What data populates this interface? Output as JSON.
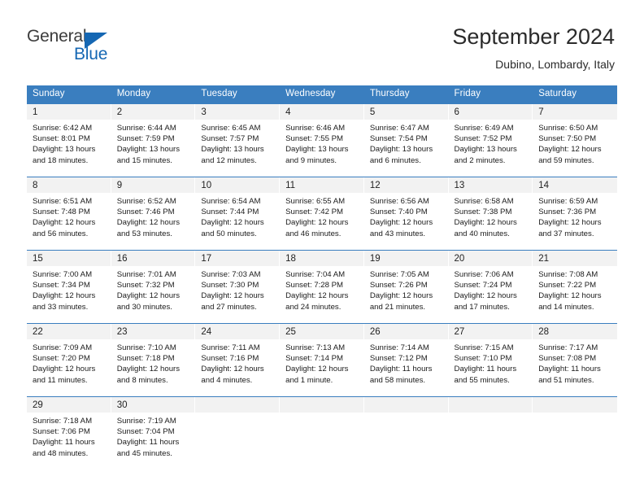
{
  "brand": {
    "name_part1": "General",
    "name_part2": "Blue",
    "accent_color": "#1567b3"
  },
  "header": {
    "title": "September 2024",
    "location": "Dubino, Lombardy, Italy"
  },
  "theme": {
    "header_band": "#3a7ebf",
    "day_band": "#f2f2f2"
  },
  "weekdays": [
    "Sunday",
    "Monday",
    "Tuesday",
    "Wednesday",
    "Thursday",
    "Friday",
    "Saturday"
  ],
  "weeks": [
    [
      {
        "day": "1",
        "sunrise": "Sunrise: 6:42 AM",
        "sunset": "Sunset: 8:01 PM",
        "daylight_line1": "Daylight: 13 hours",
        "daylight_line2": "and 18 minutes."
      },
      {
        "day": "2",
        "sunrise": "Sunrise: 6:44 AM",
        "sunset": "Sunset: 7:59 PM",
        "daylight_line1": "Daylight: 13 hours",
        "daylight_line2": "and 15 minutes."
      },
      {
        "day": "3",
        "sunrise": "Sunrise: 6:45 AM",
        "sunset": "Sunset: 7:57 PM",
        "daylight_line1": "Daylight: 13 hours",
        "daylight_line2": "and 12 minutes."
      },
      {
        "day": "4",
        "sunrise": "Sunrise: 6:46 AM",
        "sunset": "Sunset: 7:55 PM",
        "daylight_line1": "Daylight: 13 hours",
        "daylight_line2": "and 9 minutes."
      },
      {
        "day": "5",
        "sunrise": "Sunrise: 6:47 AM",
        "sunset": "Sunset: 7:54 PM",
        "daylight_line1": "Daylight: 13 hours",
        "daylight_line2": "and 6 minutes."
      },
      {
        "day": "6",
        "sunrise": "Sunrise: 6:49 AM",
        "sunset": "Sunset: 7:52 PM",
        "daylight_line1": "Daylight: 13 hours",
        "daylight_line2": "and 2 minutes."
      },
      {
        "day": "7",
        "sunrise": "Sunrise: 6:50 AM",
        "sunset": "Sunset: 7:50 PM",
        "daylight_line1": "Daylight: 12 hours",
        "daylight_line2": "and 59 minutes."
      }
    ],
    [
      {
        "day": "8",
        "sunrise": "Sunrise: 6:51 AM",
        "sunset": "Sunset: 7:48 PM",
        "daylight_line1": "Daylight: 12 hours",
        "daylight_line2": "and 56 minutes."
      },
      {
        "day": "9",
        "sunrise": "Sunrise: 6:52 AM",
        "sunset": "Sunset: 7:46 PM",
        "daylight_line1": "Daylight: 12 hours",
        "daylight_line2": "and 53 minutes."
      },
      {
        "day": "10",
        "sunrise": "Sunrise: 6:54 AM",
        "sunset": "Sunset: 7:44 PM",
        "daylight_line1": "Daylight: 12 hours",
        "daylight_line2": "and 50 minutes."
      },
      {
        "day": "11",
        "sunrise": "Sunrise: 6:55 AM",
        "sunset": "Sunset: 7:42 PM",
        "daylight_line1": "Daylight: 12 hours",
        "daylight_line2": "and 46 minutes."
      },
      {
        "day": "12",
        "sunrise": "Sunrise: 6:56 AM",
        "sunset": "Sunset: 7:40 PM",
        "daylight_line1": "Daylight: 12 hours",
        "daylight_line2": "and 43 minutes."
      },
      {
        "day": "13",
        "sunrise": "Sunrise: 6:58 AM",
        "sunset": "Sunset: 7:38 PM",
        "daylight_line1": "Daylight: 12 hours",
        "daylight_line2": "and 40 minutes."
      },
      {
        "day": "14",
        "sunrise": "Sunrise: 6:59 AM",
        "sunset": "Sunset: 7:36 PM",
        "daylight_line1": "Daylight: 12 hours",
        "daylight_line2": "and 37 minutes."
      }
    ],
    [
      {
        "day": "15",
        "sunrise": "Sunrise: 7:00 AM",
        "sunset": "Sunset: 7:34 PM",
        "daylight_line1": "Daylight: 12 hours",
        "daylight_line2": "and 33 minutes."
      },
      {
        "day": "16",
        "sunrise": "Sunrise: 7:01 AM",
        "sunset": "Sunset: 7:32 PM",
        "daylight_line1": "Daylight: 12 hours",
        "daylight_line2": "and 30 minutes."
      },
      {
        "day": "17",
        "sunrise": "Sunrise: 7:03 AM",
        "sunset": "Sunset: 7:30 PM",
        "daylight_line1": "Daylight: 12 hours",
        "daylight_line2": "and 27 minutes."
      },
      {
        "day": "18",
        "sunrise": "Sunrise: 7:04 AM",
        "sunset": "Sunset: 7:28 PM",
        "daylight_line1": "Daylight: 12 hours",
        "daylight_line2": "and 24 minutes."
      },
      {
        "day": "19",
        "sunrise": "Sunrise: 7:05 AM",
        "sunset": "Sunset: 7:26 PM",
        "daylight_line1": "Daylight: 12 hours",
        "daylight_line2": "and 21 minutes."
      },
      {
        "day": "20",
        "sunrise": "Sunrise: 7:06 AM",
        "sunset": "Sunset: 7:24 PM",
        "daylight_line1": "Daylight: 12 hours",
        "daylight_line2": "and 17 minutes."
      },
      {
        "day": "21",
        "sunrise": "Sunrise: 7:08 AM",
        "sunset": "Sunset: 7:22 PM",
        "daylight_line1": "Daylight: 12 hours",
        "daylight_line2": "and 14 minutes."
      }
    ],
    [
      {
        "day": "22",
        "sunrise": "Sunrise: 7:09 AM",
        "sunset": "Sunset: 7:20 PM",
        "daylight_line1": "Daylight: 12 hours",
        "daylight_line2": "and 11 minutes."
      },
      {
        "day": "23",
        "sunrise": "Sunrise: 7:10 AM",
        "sunset": "Sunset: 7:18 PM",
        "daylight_line1": "Daylight: 12 hours",
        "daylight_line2": "and 8 minutes."
      },
      {
        "day": "24",
        "sunrise": "Sunrise: 7:11 AM",
        "sunset": "Sunset: 7:16 PM",
        "daylight_line1": "Daylight: 12 hours",
        "daylight_line2": "and 4 minutes."
      },
      {
        "day": "25",
        "sunrise": "Sunrise: 7:13 AM",
        "sunset": "Sunset: 7:14 PM",
        "daylight_line1": "Daylight: 12 hours",
        "daylight_line2": "and 1 minute."
      },
      {
        "day": "26",
        "sunrise": "Sunrise: 7:14 AM",
        "sunset": "Sunset: 7:12 PM",
        "daylight_line1": "Daylight: 11 hours",
        "daylight_line2": "and 58 minutes."
      },
      {
        "day": "27",
        "sunrise": "Sunrise: 7:15 AM",
        "sunset": "Sunset: 7:10 PM",
        "daylight_line1": "Daylight: 11 hours",
        "daylight_line2": "and 55 minutes."
      },
      {
        "day": "28",
        "sunrise": "Sunrise: 7:17 AM",
        "sunset": "Sunset: 7:08 PM",
        "daylight_line1": "Daylight: 11 hours",
        "daylight_line2": "and 51 minutes."
      }
    ],
    [
      {
        "day": "29",
        "sunrise": "Sunrise: 7:18 AM",
        "sunset": "Sunset: 7:06 PM",
        "daylight_line1": "Daylight: 11 hours",
        "daylight_line2": "and 48 minutes."
      },
      {
        "day": "30",
        "sunrise": "Sunrise: 7:19 AM",
        "sunset": "Sunset: 7:04 PM",
        "daylight_line1": "Daylight: 11 hours",
        "daylight_line2": "and 45 minutes."
      },
      {
        "day": "",
        "sunrise": "",
        "sunset": "",
        "daylight_line1": "",
        "daylight_line2": ""
      },
      {
        "day": "",
        "sunrise": "",
        "sunset": "",
        "daylight_line1": "",
        "daylight_line2": ""
      },
      {
        "day": "",
        "sunrise": "",
        "sunset": "",
        "daylight_line1": "",
        "daylight_line2": ""
      },
      {
        "day": "",
        "sunrise": "",
        "sunset": "",
        "daylight_line1": "",
        "daylight_line2": ""
      },
      {
        "day": "",
        "sunrise": "",
        "sunset": "",
        "daylight_line1": "",
        "daylight_line2": ""
      }
    ]
  ]
}
